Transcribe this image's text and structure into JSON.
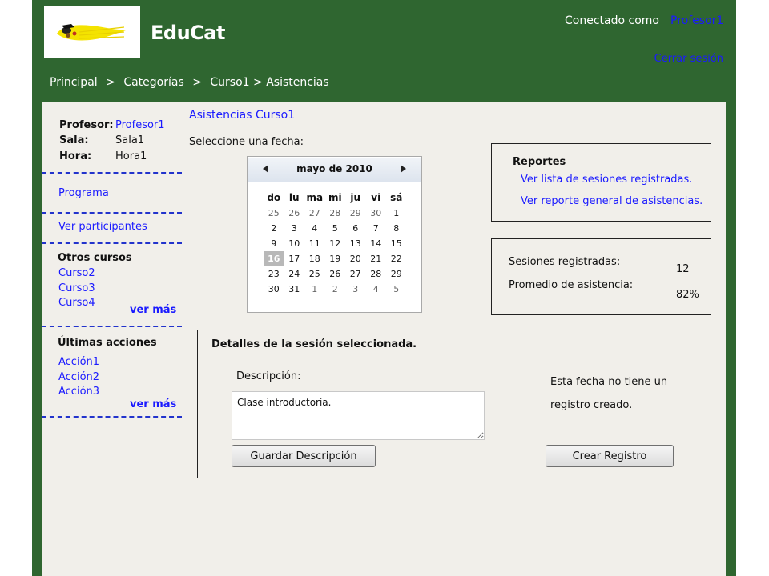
{
  "header": {
    "app_title": "EduCat",
    "logged_in_label": "Conectado como",
    "logged_in_user": "Profesor1",
    "logout": "Cerrar sesión"
  },
  "breadcrumb": [
    "Principal",
    ">",
    "Categorías",
    ">",
    "Curso1 > Asistencias"
  ],
  "sidebar": {
    "info": [
      {
        "label": "Profesor:",
        "value": "Profesor1"
      },
      {
        "label": "Sala:",
        "value": "Sala1"
      },
      {
        "label": "Hora:",
        "value": "Hora1"
      }
    ],
    "program_link": "Programa",
    "participants_link": "Ver participantes",
    "other_courses_title": "Otros cursos",
    "other_courses": [
      "Curso2",
      "Curso3",
      "Curso4"
    ],
    "other_courses_more": "ver más",
    "recent_actions_title": "Últimas acciones",
    "recent_actions": [
      "Acción1",
      "Acción2",
      "Acción3"
    ],
    "recent_actions_more": "ver más"
  },
  "main": {
    "title": "Asistencias Curso1",
    "date_prompt": "Seleccione una fecha:"
  },
  "calendar": {
    "title": "mayo de 2010",
    "weekdays": [
      "do",
      "lu",
      "ma",
      "mi",
      "ju",
      "vi",
      "sá"
    ],
    "weeks": [
      [
        "25",
        "26",
        "27",
        "28",
        "29",
        "30",
        "1"
      ],
      [
        "2",
        "3",
        "4",
        "5",
        "6",
        "7",
        "8"
      ],
      [
        "9",
        "10",
        "11",
        "12",
        "13",
        "14",
        "15"
      ],
      [
        "16",
        "17",
        "18",
        "19",
        "20",
        "21",
        "22"
      ],
      [
        "23",
        "24",
        "25",
        "26",
        "27",
        "28",
        "29"
      ],
      [
        "30",
        "31",
        "1",
        "2",
        "3",
        "4",
        "5"
      ]
    ],
    "selected_day": "16"
  },
  "reports": {
    "title": "Reportes",
    "links": [
      "Ver lista de sesiones registradas.",
      "Ver reporte general de asistencias."
    ]
  },
  "stats": {
    "sessions_label": "Sesiones registradas:",
    "sessions_value": "12",
    "attendance_label": "Promedio de asistencia:",
    "attendance_value": "82%"
  },
  "details": {
    "title": "Detalles de la sesión seleccionada.",
    "description_label": "Descripción:",
    "description_value": "Clase introductoria.",
    "save_button": "Guardar Descripción",
    "note": "Esta fecha no tiene un registro creado.",
    "create_button": "Crear Registro"
  },
  "colors": {
    "header_green": "#2f6630",
    "content_bg": "#f1efea",
    "link_blue": "#1a1aff"
  }
}
